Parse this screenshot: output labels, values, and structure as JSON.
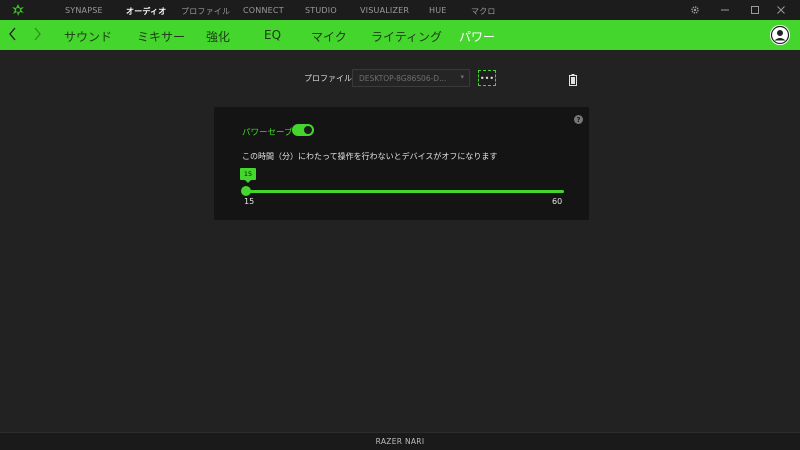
{
  "app": {
    "accent_color": "#44d62c",
    "logo_icon": "razer-snake-logo"
  },
  "top_nav": {
    "items": [
      "SYNAPSE",
      "オーディオ",
      "プロファイル",
      "CONNECT",
      "STUDIO",
      "VISUALIZER",
      "HUE",
      "マクロ"
    ],
    "active": "オーディオ"
  },
  "window_controls": {
    "settings_icon": "gear-icon",
    "minimize_icon": "minimize-icon",
    "maximize_icon": "maximize-icon",
    "close_icon": "close-icon"
  },
  "sub_nav": {
    "back_icon": "chevron-left-icon",
    "forward_icon": "chevron-right-icon",
    "tabs": [
      "サウンド",
      "ミキサー",
      "強化",
      "EQ",
      "マイク",
      "ライティング",
      "パワー"
    ],
    "active": "パワー",
    "avatar_icon": "user-avatar-icon"
  },
  "profile": {
    "label": "プロファイル",
    "selected": "DESKTOP-8G86S06-D...",
    "more_label": "•••",
    "battery_icon": "battery-icon"
  },
  "power": {
    "power_save_label": "パワーセーブ",
    "power_save_enabled": true,
    "help_label": "?",
    "description": "この時間（分）にわたって操作を行わないとデバイスがオフになります",
    "slider_value": "15",
    "slider_min": "15",
    "slider_max": "60"
  },
  "footer": {
    "device_name": "RAZER NARI"
  }
}
